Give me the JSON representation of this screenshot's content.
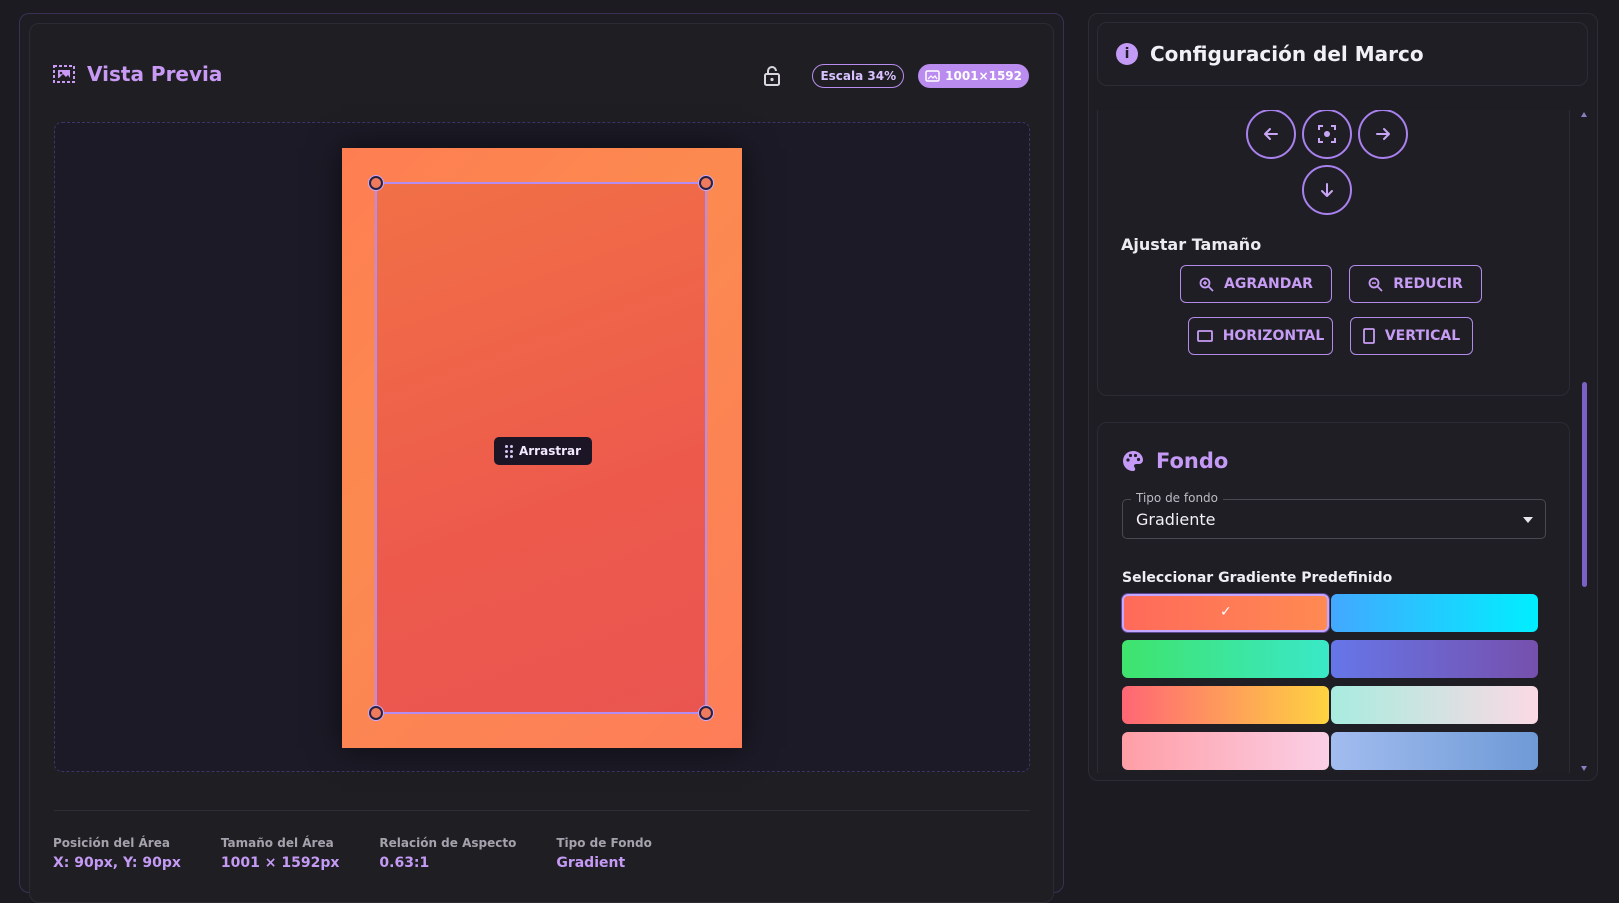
{
  "preview": {
    "title": "Vista Previa",
    "scale_badge": "Escala 34%",
    "dimensions_badge": "1001×1592",
    "drag_label": "Arrastrar"
  },
  "stats": [
    {
      "label": "Posición del Área",
      "value": "X: 90px, Y: 90px"
    },
    {
      "label": "Tamaño del Área",
      "value": "1001 × 1592px"
    },
    {
      "label": "Relación de Aspecto",
      "value": "0.63:1"
    },
    {
      "label": "Tipo de Fondo",
      "value": "Gradient"
    }
  ],
  "config": {
    "title": "Configuración del Marco",
    "info_icon": "i"
  },
  "size": {
    "label": "Ajustar Tamaño",
    "grow": "AGRANDAR",
    "shrink": "REDUCIR",
    "horizontal": "HORIZONTAL",
    "vertical": "VERTICAL"
  },
  "background": {
    "title": "Fondo",
    "type_legend": "Tipo de fondo",
    "type_value": "Gradiente",
    "preset_label": "Seleccionar Gradiente Predefinido",
    "selected_check": "✓",
    "presets": [
      {
        "from": "#ff6a5a",
        "to": "#ff8a52",
        "selected": true
      },
      {
        "from": "#43a8ff",
        "to": "#00efff",
        "selected": false
      },
      {
        "from": "#3fe36c",
        "to": "#3ae8c8",
        "selected": false
      },
      {
        "from": "#6676e8",
        "to": "#7650ad",
        "selected": false
      },
      {
        "from": "#ff6675",
        "to": "#fed340",
        "selected": false
      },
      {
        "from": "#a8ecdf",
        "to": "#fbd9e4",
        "selected": false
      },
      {
        "from": "#ff9ea6",
        "to": "#fbcfe6",
        "selected": false
      },
      {
        "from": "#a2bcef",
        "to": "#6e9ad6",
        "selected": false
      }
    ]
  },
  "colors": {
    "accent": "#c49af5",
    "panel": "#1f1e24",
    "frame_gradient_start": "#fe7e52",
    "crop_gradient": "#ed5a4c"
  }
}
